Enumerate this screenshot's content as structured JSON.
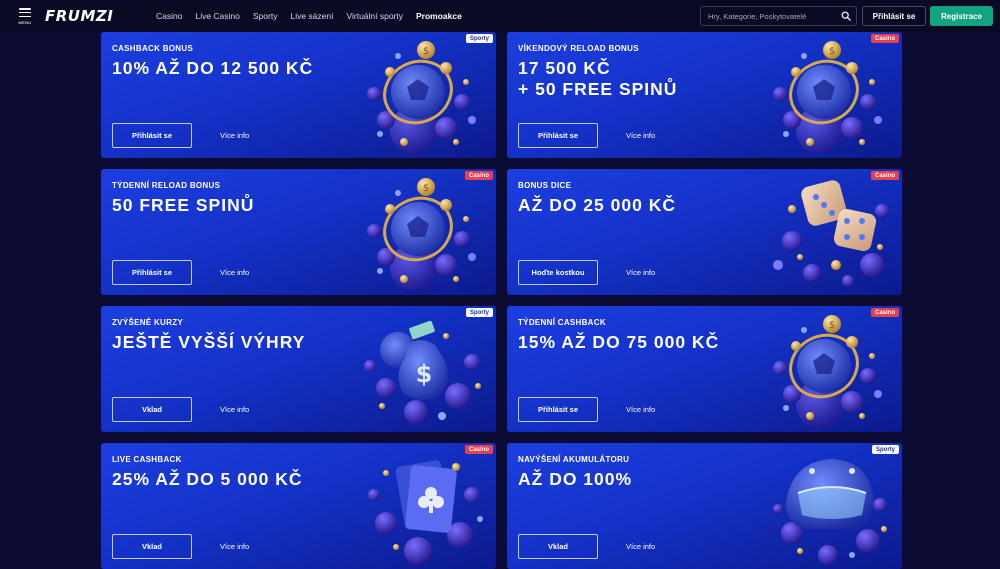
{
  "header": {
    "menu_label": "MENU",
    "logo_text": "FRUMZI",
    "nav": [
      "Casino",
      "Live Casino",
      "Sporty",
      "Live sázení",
      "Virtuální sporty",
      "Promoakce"
    ],
    "search_placeholder": "Hry, Kategorie, Poskytovatelé",
    "login_label": "Přihlásit se",
    "register_label": "Registrace"
  },
  "colors": {
    "background": "#0c0b33",
    "header_bg": "#0a0a24",
    "card_blue": "#1432c8",
    "register_green": "#14a37f",
    "casino_badge": "#e64150",
    "sport_badge": "#ffffff"
  },
  "cards": [
    {
      "subtitle": "CASHBACK BONUS",
      "title_lines": [
        "10% AŽ DO 12 500 KČ"
      ],
      "cta": "Přihlásit se",
      "more": "Více info",
      "badge": "Sporty",
      "art": "ball-coins-icon"
    },
    {
      "subtitle": "VÍKENDOVÝ RELOAD BONUS",
      "title_lines": [
        "17 500 KČ",
        "+ 50 FREE SPINŮ"
      ],
      "cta": "Přihlásit se",
      "more": "Více info",
      "badge": "Casino",
      "art": "ball-coins-icon"
    },
    {
      "subtitle": "TÝDENNÍ RELOAD BONUS",
      "title_lines": [
        "50 FREE SPINŮ"
      ],
      "cta": "Přihlásit se",
      "more": "Více info",
      "badge": "Casino",
      "art": "ball-coins-icon"
    },
    {
      "subtitle": "BONUS DICE",
      "title_lines": [
        "AŽ DO 25 000 KČ"
      ],
      "cta": "Hoďte kostkou",
      "more": "Více info",
      "badge": "Casino",
      "art": "dice-icon"
    },
    {
      "subtitle": "ZVÝŠENÉ KURZY",
      "title_lines": [
        "JEŠTĚ VYŠŠÍ VÝHRY"
      ],
      "cta": "Vklad",
      "more": "Více info",
      "badge": "Sporty",
      "art": "money-bag-icon"
    },
    {
      "subtitle": "TÝDENNÍ CASHBACK",
      "title_lines": [
        "15% AŽ DO 75 000 KČ"
      ],
      "cta": "Přihlásit se",
      "more": "Více info",
      "badge": "Casino",
      "art": "ball-coins-icon"
    },
    {
      "subtitle": "LIVE CASHBACK",
      "title_lines": [
        "25% AŽ DO 5 000 KČ"
      ],
      "cta": "Vklad",
      "more": "Více info",
      "badge": "Casino",
      "art": "playing-cards-icon"
    },
    {
      "subtitle": "NAVÝŠENÍ AKUMULÁTORU",
      "title_lines": [
        "AŽ DO 100%"
      ],
      "cta": "Vklad",
      "more": "Více info",
      "badge": "Sporty",
      "art": "helmet-icon"
    }
  ]
}
